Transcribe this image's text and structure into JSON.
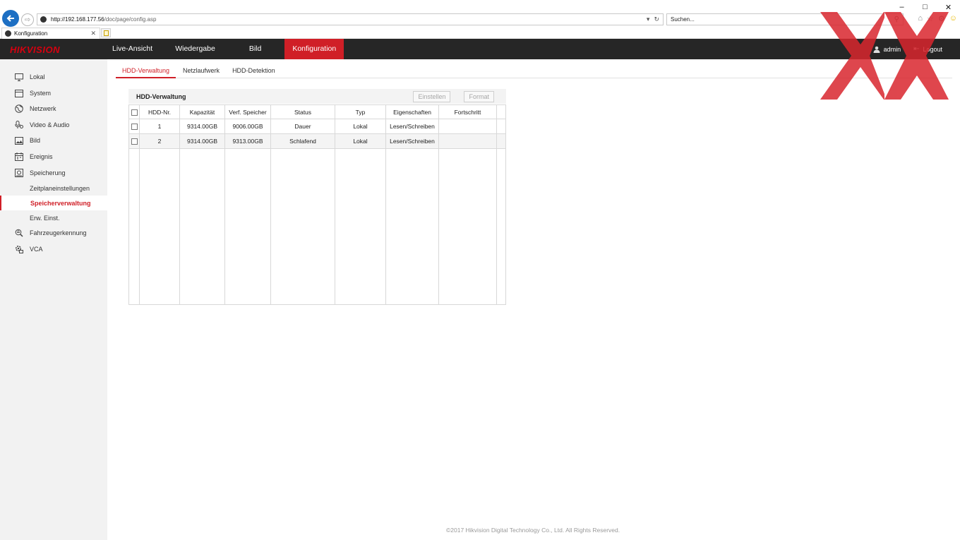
{
  "browser": {
    "url_host": "http://192.168.177.56",
    "url_path": "/doc/page/config.asp",
    "search_placeholder": "Suchen...",
    "tab_title": "Konfiguration"
  },
  "app": {
    "logo_part1": "HIK",
    "logo_part2": "VISION",
    "nav": [
      "Live-Ansicht",
      "Wiedergabe",
      "Bild",
      "Konfiguration"
    ],
    "nav_selected": "Konfiguration",
    "user": "admin",
    "logout": "Logout"
  },
  "sidebar": {
    "items": [
      {
        "label": "Lokal",
        "icon": "monitor-icon"
      },
      {
        "label": "System",
        "icon": "window-icon"
      },
      {
        "label": "Netzwerk",
        "icon": "globe-icon"
      },
      {
        "label": "Video & Audio",
        "icon": "mic-icon"
      },
      {
        "label": "Bild",
        "icon": "image-icon"
      },
      {
        "label": "Ereignis",
        "icon": "calendar-icon"
      },
      {
        "label": "Speicherung",
        "icon": "storage-icon"
      }
    ],
    "sub_items": [
      "Zeitplaneinstellungen",
      "Speicherverwaltung",
      "Erw. Einst."
    ],
    "sub_selected": "Speicherverwaltung",
    "items_after": [
      {
        "label": "Fahrzeugerkennung",
        "icon": "vehicle-icon"
      },
      {
        "label": "VCA",
        "icon": "gear-camera-icon"
      }
    ]
  },
  "subtabs": [
    "HDD-Verwaltung",
    "Netzlaufwerk",
    "HDD-Detektion"
  ],
  "subtab_selected": "HDD-Verwaltung",
  "panel": {
    "title": "HDD-Verwaltung",
    "btn_set": "Einstellen",
    "btn_format": "Format"
  },
  "table": {
    "columns": [
      "HDD-Nr.",
      "Kapazität",
      "Verf. Speicher",
      "Status",
      "Typ",
      "Eigenschaften",
      "Fortschritt"
    ],
    "rows": [
      [
        "1",
        "9314.00GB",
        "9006.00GB",
        "Dauer",
        "Lokal",
        "Lesen/Schreiben",
        ""
      ],
      [
        "2",
        "9314.00GB",
        "9313.00GB",
        "Schlafend",
        "Lokal",
        "Lesen/Schreiben",
        ""
      ]
    ]
  },
  "footer": "©2017 Hikvision Digital Technology Co., Ltd. All Rights Reserved.",
  "colors": {
    "accent": "#d01f27",
    "topbar": "#262626",
    "sidebar": "#f2f2f2"
  }
}
